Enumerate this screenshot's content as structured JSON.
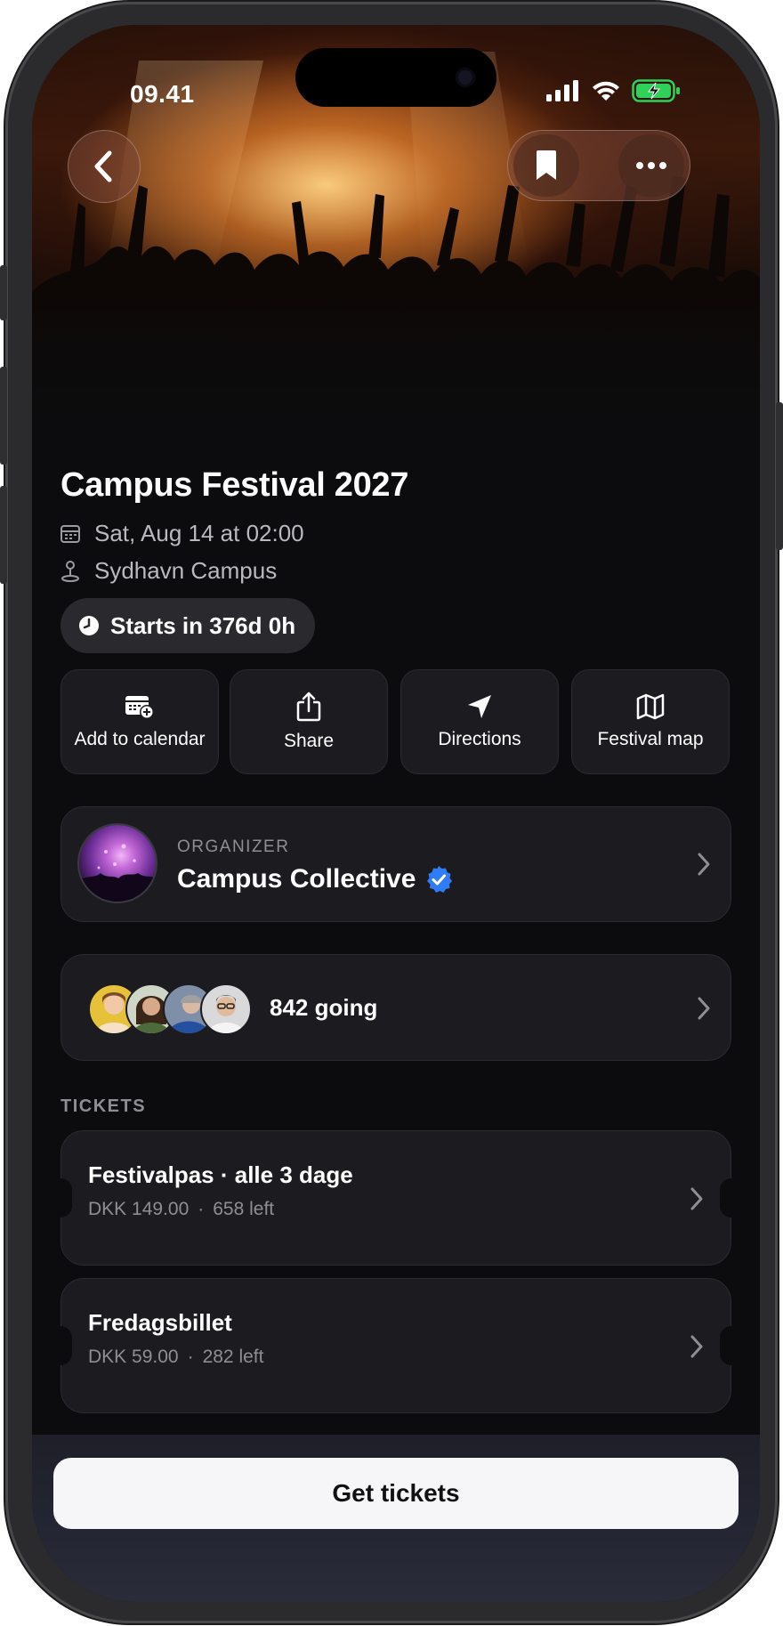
{
  "status": {
    "time": "09.41",
    "icons": [
      "signal-icon",
      "wifi-icon",
      "battery-charging-icon"
    ],
    "battery_color": "#30d158"
  },
  "nav": {
    "back_icon": "chevron-left-icon",
    "bookmark_icon": "bookmark-icon",
    "more_icon": "ellipsis-icon"
  },
  "event": {
    "title": "Campus Festival 2027",
    "date": "Sat, Aug 14 at 02:00",
    "location": "Sydhavn Campus",
    "countdown": "Starts in 376d 0h"
  },
  "actions": [
    {
      "label": "Add to calendar",
      "icon": "calendar-add-icon"
    },
    {
      "label": "Share",
      "icon": "share-icon"
    },
    {
      "label": "Directions",
      "icon": "navigation-arrow-icon"
    },
    {
      "label": "Festival map",
      "icon": "map-icon"
    }
  ],
  "organizer": {
    "label": "ORGANIZER",
    "name": "Campus Collective",
    "verified_color": "#2f7cf6"
  },
  "attendees": {
    "going": "842 going"
  },
  "tickets": {
    "section_label": "TICKETS",
    "items": [
      {
        "name": "Festivalpas · alle 3 dage",
        "price": "DKK 149.00",
        "sep": "·",
        "left": "658 left"
      },
      {
        "name": "Fredagsbillet",
        "price": "DKK 59.00",
        "sep": "·",
        "left": "282 left"
      }
    ]
  },
  "cta": {
    "label": "Get tickets"
  },
  "colors": {
    "background": "#0c0c0e",
    "card": "#1c1c20",
    "accent_blue": "#2f7cf6"
  }
}
